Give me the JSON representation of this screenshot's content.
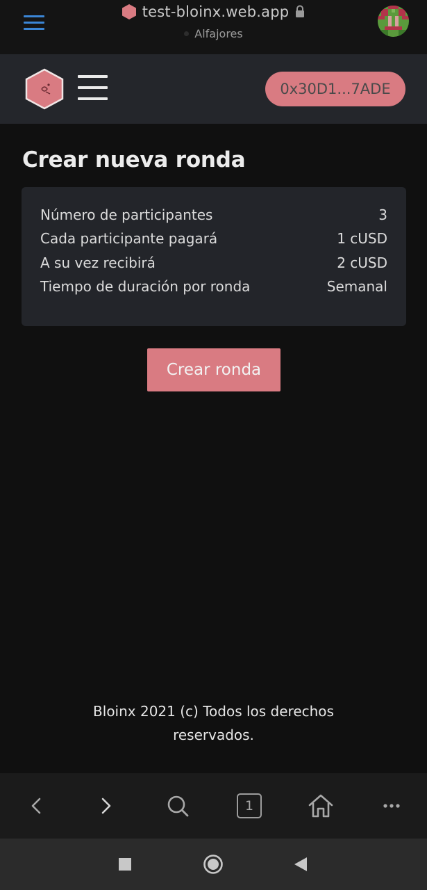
{
  "browser": {
    "url": "test-bloinx.web.app",
    "network": "Alfajores",
    "open_tabs": "1"
  },
  "header": {
    "wallet_address": "0x30D1...7ADE"
  },
  "main": {
    "title": "Crear nueva ronda",
    "summary": [
      {
        "label": "Número de participantes",
        "value": "3"
      },
      {
        "label": "Cada participante pagará",
        "value": "1 cUSD"
      },
      {
        "label": "A su vez recibirá",
        "value": "2 cUSD"
      },
      {
        "label": "Tiempo de duración por ronda",
        "value": "Semanal"
      }
    ],
    "create_button_label": "Crear ronda"
  },
  "footer": {
    "line1": "Bloinx 2021 (c) Todos los derechos",
    "line2": "reservados."
  },
  "colors": {
    "accent": "#d97b82",
    "browser_menu": "#3b86d6",
    "card_bg": "#23252a",
    "header_bg": "#24262b",
    "page_bg": "#101010"
  }
}
